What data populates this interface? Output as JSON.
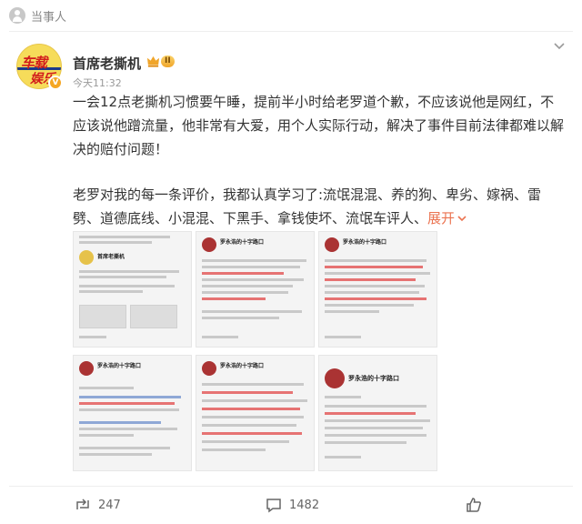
{
  "topbar": {
    "label": "当事人"
  },
  "post": {
    "author": "首席老撕机",
    "level": "II",
    "verified_mark": "V",
    "time": "今天11:32",
    "avatar_text_top": "车载",
    "avatar_text_bottom": "娱乐",
    "paragraph1": "一会12点老撕机习惯要午睡，提前半小时给老罗道个歉，不应该说他是网红，不应该说他蹭流量，他非常有大爱，用个人实际行动，解决了事件目前法律都难以解决的赔付问题！",
    "paragraph2": "老罗对我的每一条评价，我都认真学习了:流氓混混、养的狗、卑劣、嫁祸、雷劈、道德底线、小混混、下黑手、拿钱使坏、流氓车评人、",
    "expand_label": "展开",
    "expand_icon": "chevron-down-icon",
    "more_icon": "chevron-down-icon"
  },
  "images": [
    {
      "name": "首席老撕机"
    },
    {
      "name": "罗永浩的十字路口"
    },
    {
      "name": "罗永浩的十字路口"
    },
    {
      "name": "罗永浩的十字路口"
    },
    {
      "name": "罗永浩的十字路口"
    },
    {
      "name": "罗永浩的十字路口"
    }
  ],
  "actions": {
    "repost_count": "247",
    "comment_count": "1482"
  },
  "colors": {
    "accent": "#eb7350",
    "level_badge": "#f0a52a",
    "text": "#333333"
  }
}
